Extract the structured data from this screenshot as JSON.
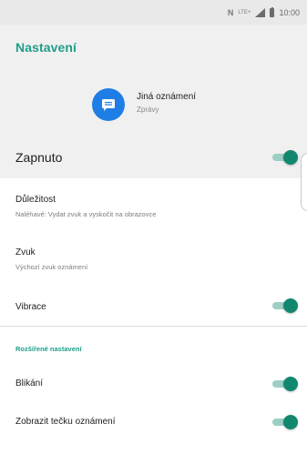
{
  "status_bar": {
    "n_indicator": "N",
    "network_type": "LTE+",
    "time": "10:00",
    "icons": [
      "nfc-icon",
      "network-type-icon",
      "signal-icon",
      "battery-icon"
    ]
  },
  "app_bar": {
    "title": "Nastavení"
  },
  "header": {
    "icon": "message-icon",
    "channel_name": "Jiná oznámení",
    "app_name": "Zprávy"
  },
  "master": {
    "label": "Zapnuto",
    "enabled": true
  },
  "settings": {
    "importance": {
      "title": "Důležitost",
      "summary": "Naléhavé: Vydat zvuk a vyskočit na obrazovce"
    },
    "sound": {
      "title": "Zvuk",
      "summary": "Výchozí zvuk oznámení"
    },
    "vibration": {
      "title": "Vibrace",
      "enabled": true
    }
  },
  "advanced": {
    "section_title": "Rozšířené nastavení",
    "blink": {
      "title": "Blikání",
      "enabled": true
    },
    "dot": {
      "title": "Zobrazit tečku oznámení",
      "enabled": true
    }
  },
  "colors": {
    "accent": "#1f9e8a",
    "toggle_thumb": "#12876f",
    "toggle_track": "#9ccfc4",
    "app_icon_bg": "#1e7ee6",
    "header_bg": "#f0f0f0"
  }
}
